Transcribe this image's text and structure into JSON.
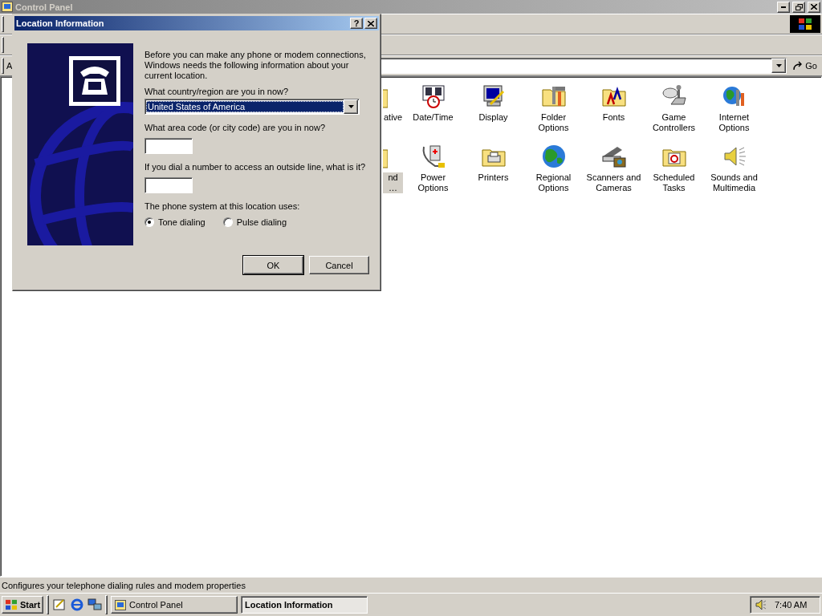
{
  "window": {
    "title": "Control Panel"
  },
  "address_bar": {
    "label": "A",
    "go_button": "Go"
  },
  "icons": [
    {
      "label": "ative",
      "kind": "sliver",
      "selected": false
    },
    {
      "label": "Date/Time",
      "kind": "calendar",
      "selected": false
    },
    {
      "label": "Display",
      "kind": "monitor",
      "selected": false
    },
    {
      "label": "Folder Options",
      "kind": "folder-tools",
      "selected": false
    },
    {
      "label": "Fonts",
      "kind": "folder-fonts",
      "selected": false
    },
    {
      "label": "Game Controllers",
      "kind": "joystick",
      "selected": false
    },
    {
      "label": "Internet Options",
      "kind": "globe-tools",
      "selected": false
    },
    {
      "label": "nd …",
      "kind": "sliver",
      "selected": true
    },
    {
      "label": "Power Options",
      "kind": "plug",
      "selected": false
    },
    {
      "label": "Printers",
      "kind": "folder-printer",
      "selected": false
    },
    {
      "label": "Regional Options",
      "kind": "globe",
      "selected": false
    },
    {
      "label": "Scanners and Cameras",
      "kind": "scanner",
      "selected": false
    },
    {
      "label": "Scheduled Tasks",
      "kind": "folder-clock",
      "selected": false
    },
    {
      "label": "Sounds and Multimedia",
      "kind": "speaker",
      "selected": false
    }
  ],
  "status_bar": "Configures your telephone dialing rules and modem properties",
  "dialog": {
    "title": "Location Information",
    "help_button": "?",
    "intro": "Before you can make any phone or modem connections, Windows needs the following information about your current location.",
    "country": {
      "label": "What country/region are you in now?",
      "value": "United States of America"
    },
    "area_code": {
      "label": "What area code (or city code) are you in now?"
    },
    "outside_line": {
      "label": "If you dial a number to access an outside line, what is it?"
    },
    "phone_system": {
      "label": "The phone system at this location uses:",
      "options": [
        {
          "label": "Tone dialing",
          "selected": true
        },
        {
          "label": "Pulse dialing",
          "selected": false
        }
      ]
    },
    "buttons": [
      {
        "label": "OK",
        "default": true
      },
      {
        "label": "Cancel",
        "default": false
      }
    ]
  },
  "taskbar": {
    "start": "Start",
    "tasks": [
      {
        "label": "Control Panel",
        "selected": false
      },
      {
        "label": "Location Information",
        "selected": true
      }
    ],
    "clock": "7:40 AM"
  }
}
